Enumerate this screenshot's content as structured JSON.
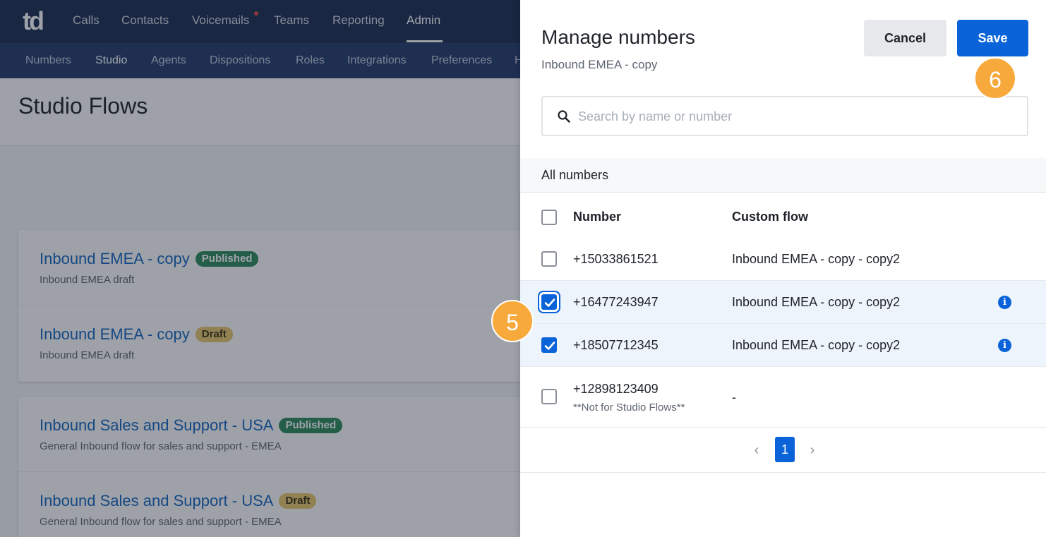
{
  "app": {
    "logo_text": "td",
    "topnav": [
      "Calls",
      "Contacts",
      "Voicemails",
      "Teams",
      "Reporting",
      "Admin"
    ],
    "subnav": [
      "Numbers",
      "Studio",
      "Agents",
      "Dispositions",
      "Roles",
      "Integrations",
      "Preferences",
      "H"
    ],
    "page_title": "Studio Flows",
    "flows": [
      {
        "name": "Inbound EMEA - copy",
        "status": "Published",
        "description": "Inbound EMEA draft"
      },
      {
        "name": "Inbound EMEA - copy",
        "status": "Draft",
        "description": "Inbound EMEA draft"
      },
      {
        "name": "Inbound Sales and Support - USA",
        "status": "Published",
        "description": "General Inbound flow for sales and support - EMEA"
      },
      {
        "name": "Inbound Sales and Support - USA",
        "status": "Draft",
        "description": "General Inbound flow for sales and support - EMEA"
      }
    ]
  },
  "drawer": {
    "title": "Manage numbers",
    "subtitle": "Inbound EMEA - copy",
    "cancel_label": "Cancel",
    "save_label": "Save",
    "search_placeholder": "Search by name or number",
    "section_title": "All numbers",
    "columns": {
      "number": "Number",
      "custom_flow": "Custom flow"
    },
    "rows": [
      {
        "number": "+15033861521",
        "custom_flow": "Inbound EMEA - copy - copy2",
        "checked": false,
        "info": false
      },
      {
        "number": "+16477243947",
        "custom_flow": "Inbound EMEA - copy - copy2",
        "checked": true,
        "info": true
      },
      {
        "number": "+18507712345",
        "custom_flow": "Inbound EMEA - copy - copy2",
        "checked": true,
        "info": true
      },
      {
        "number": "+12898123409",
        "note": "**Not for Studio Flows**",
        "custom_flow": "-",
        "checked": false,
        "info": false
      }
    ],
    "pagination": {
      "current_page": "1"
    }
  },
  "step_markers": [
    "5",
    "6"
  ],
  "colors": {
    "primary": "#0a63d9",
    "nav": "#1a2b52",
    "subnav": "#233a6b",
    "marker": "#f7a93b",
    "published": "#2e8a5c",
    "draft": "#e8c76d"
  }
}
